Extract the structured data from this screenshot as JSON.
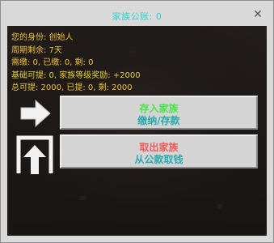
{
  "window": {
    "title": "家族公账: 0",
    "close_glyph": "✕"
  },
  "info": {
    "identity": "您的身份: 创始人",
    "period": "周期剩余: 7天",
    "dues": "需缴: 0, 已缴: 0, 剩: 0",
    "base_withdraw": "基础可提: 0, 家族等级奖励: +2000",
    "total_withdraw": "总可提: 2000, 已提: 0, 剩: 2000"
  },
  "buttons": {
    "deposit": {
      "line1": "存入家族",
      "line2": "缴纳/存款",
      "icon": "arrow-right-icon"
    },
    "withdraw": {
      "line1": "取出家族",
      "line2": "从公款取钱",
      "icon": "arrow-up-out-icon"
    }
  },
  "colors": {
    "title": "#2fd2d2",
    "info_text": "#f0c23a",
    "deposit_primary": "#45e645",
    "withdraw_primary": "#f05a5a",
    "secondary": "#2aa9ad",
    "panel_bg": "#1e1a18",
    "button_bg": "#d4d4d4"
  }
}
